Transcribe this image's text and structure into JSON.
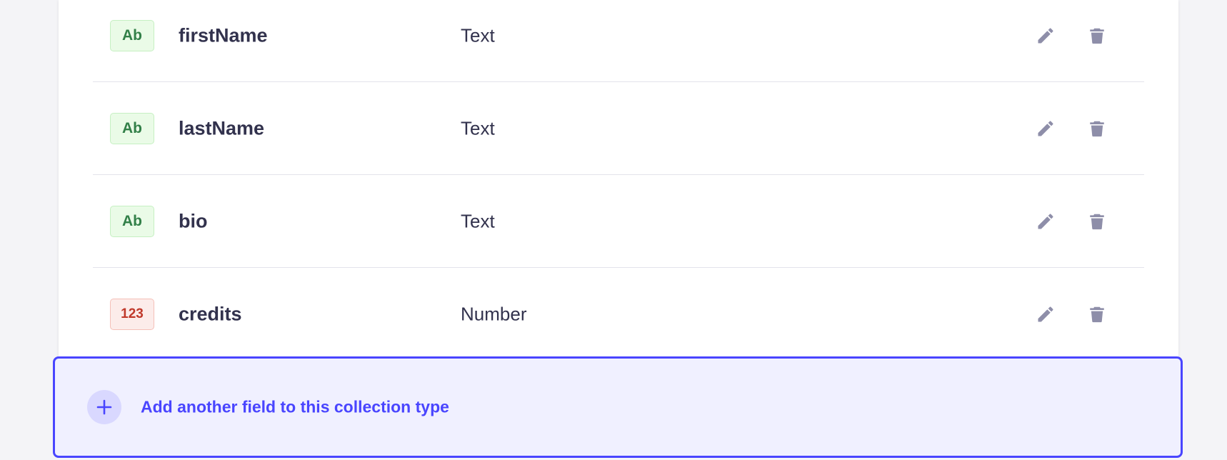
{
  "fields": [
    {
      "badge": "Ab",
      "badge_kind": "text",
      "name": "firstName",
      "type": "Text"
    },
    {
      "badge": "Ab",
      "badge_kind": "text",
      "name": "lastName",
      "type": "Text"
    },
    {
      "badge": "Ab",
      "badge_kind": "text",
      "name": "bio",
      "type": "Text"
    },
    {
      "badge": "123",
      "badge_kind": "number",
      "name": "credits",
      "type": "Number"
    }
  ],
  "icons": {
    "edit": "pencil-icon",
    "delete": "trash-icon",
    "add": "plus-icon"
  },
  "add_field": {
    "label": "Add another field to this collection type"
  },
  "colors": {
    "accent": "#4945ff",
    "text_badge": "#328048",
    "number_badge": "#c0392b",
    "icon": "#8e8ea9"
  }
}
